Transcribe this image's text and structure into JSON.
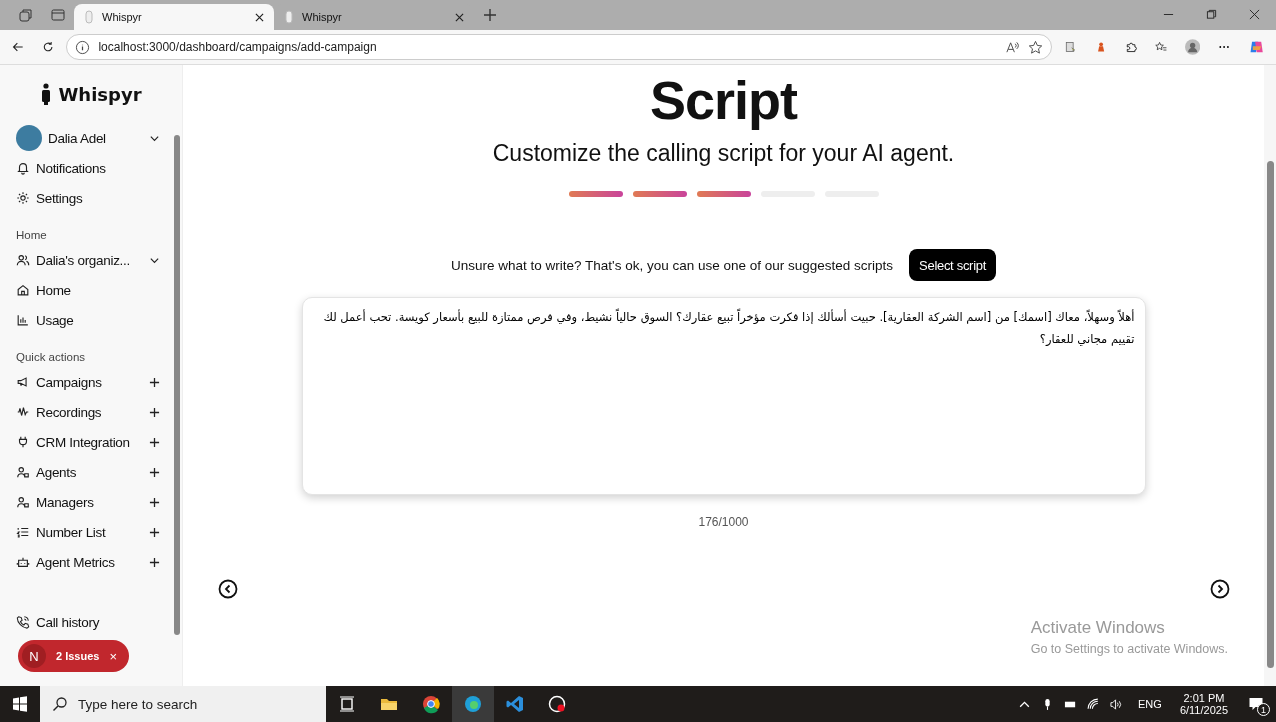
{
  "browser": {
    "tabs": [
      {
        "title": "Whispyr",
        "selected": true
      },
      {
        "title": "Whispyr",
        "selected": false
      }
    ],
    "address": "localhost:3000/dashboard/campaigns/add-campaign"
  },
  "sidebar": {
    "logo": "Whispyr",
    "user": {
      "name": "Dalia Adel"
    },
    "top_items": [
      "Notifications",
      "Settings"
    ],
    "home_section": {
      "heading": "Home",
      "organization": "Dalia's organiz...",
      "items": [
        "Home",
        "Usage"
      ]
    },
    "quick_actions": {
      "heading": "Quick actions",
      "items": [
        "Campaigns",
        "Recordings",
        "CRM Integration",
        "Agents",
        "Managers",
        "Number List",
        "Agent Metrics"
      ]
    },
    "bottom_item": "Call history"
  },
  "issues_badge": {
    "letter": "N",
    "label": "2 Issues",
    "close": "×"
  },
  "main": {
    "title": "Script",
    "subtitle": "Customize the calling script for your AI agent.",
    "steps": [
      {
        "done": true
      },
      {
        "done": true
      },
      {
        "done": true
      },
      {
        "done": false
      },
      {
        "done": false
      }
    ],
    "hint": "Unsure what to write? That's ok, you can use one of our suggested scripts",
    "select_button": "Select script",
    "script": "أهلاً وسهلاً، معاك [اسمك] من [اسم الشركة العقارية]. حبيت أسألك إذا فكرت مؤخراً تبيع عقارك؟ السوق حالياً نشيط، وفي فرص ممتازة للبيع بأسعار كويسة. تحب أعمل لك تقييم مجاني للعقار؟",
    "counter": "176/1000"
  },
  "activation": {
    "title": "Activate Windows",
    "text": "Go to Settings to activate Windows."
  },
  "taskbar": {
    "search_placeholder": "Type here to search",
    "language": "ENG",
    "time": "2:01 PM",
    "date": "6/11/2025",
    "notifications": "1"
  }
}
